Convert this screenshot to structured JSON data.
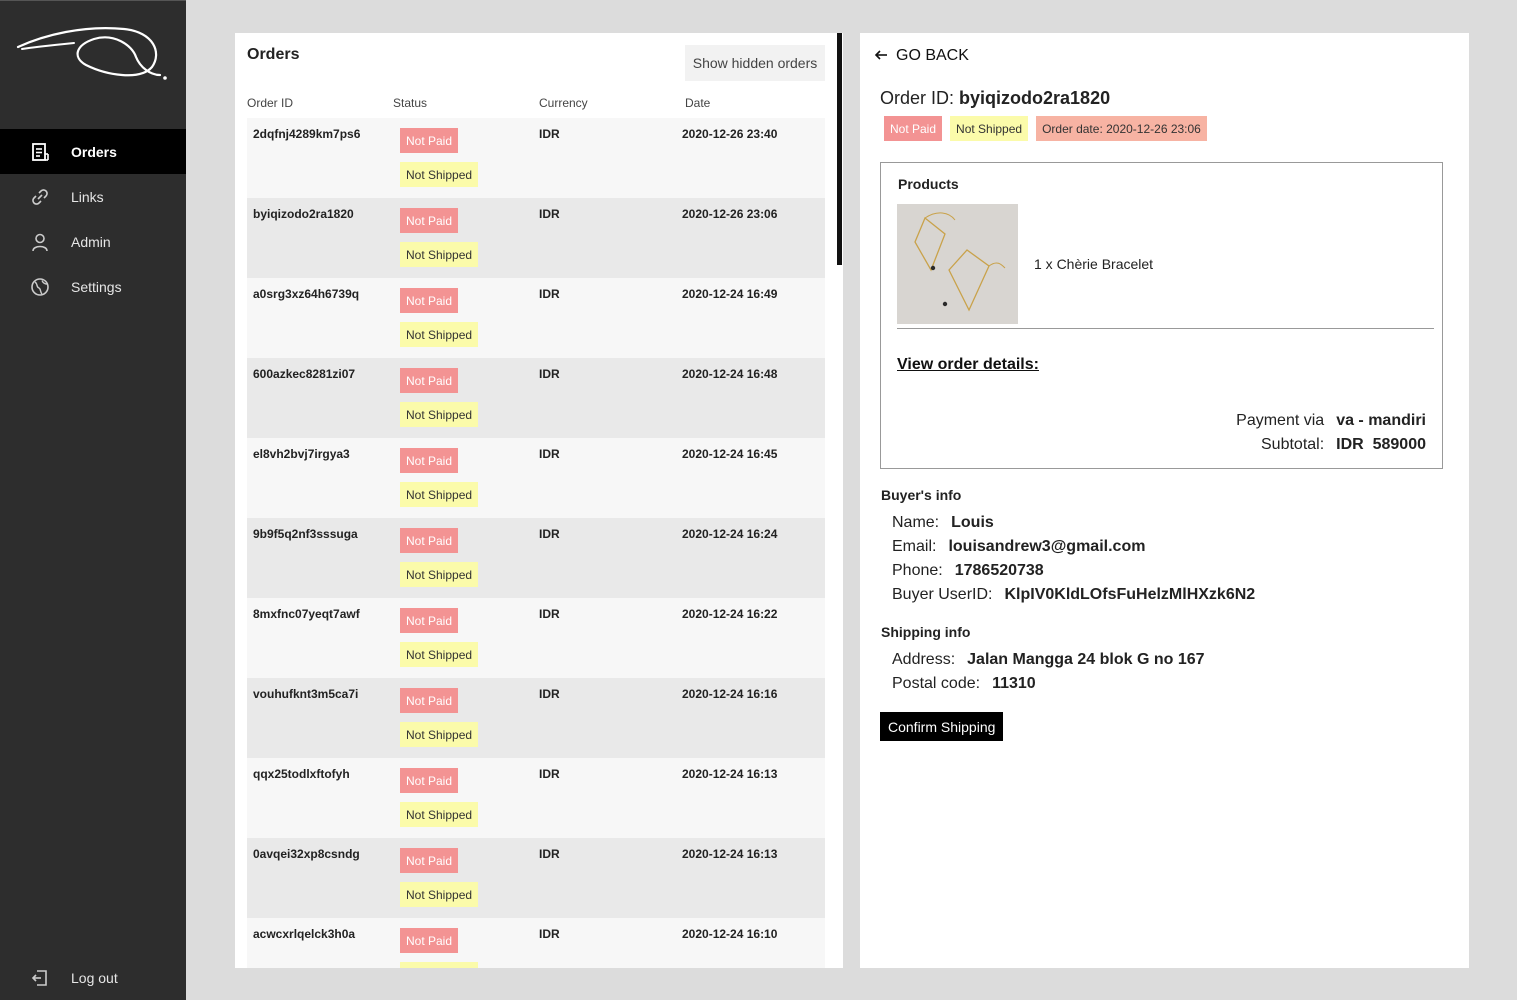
{
  "sidebar": {
    "items": [
      {
        "label": "Orders",
        "icon": "document-list-icon"
      },
      {
        "label": "Links",
        "icon": "link-icon"
      },
      {
        "label": "Admin",
        "icon": "user-icon"
      },
      {
        "label": "Settings",
        "icon": "globe-icon"
      }
    ],
    "logout_label": "Log out"
  },
  "orders": {
    "title": "Orders",
    "show_hidden_label": "Show hidden orders",
    "columns": [
      "Order ID",
      "Status",
      "Currency",
      "Date"
    ],
    "rows": [
      {
        "id": "2dqfnj4289km7ps6",
        "paid": "Not Paid",
        "shipped": "Not Shipped",
        "currency": "IDR",
        "date": "2020-12-26 23:40"
      },
      {
        "id": "byiqizodo2ra1820",
        "paid": "Not Paid",
        "shipped": "Not Shipped",
        "currency": "IDR",
        "date": "2020-12-26 23:06"
      },
      {
        "id": "a0srg3xz64h6739q",
        "paid": "Not Paid",
        "shipped": "Not Shipped",
        "currency": "IDR",
        "date": "2020-12-24 16:49"
      },
      {
        "id": "600azkec8281zi07",
        "paid": "Not Paid",
        "shipped": "Not Shipped",
        "currency": "IDR",
        "date": "2020-12-24 16:48"
      },
      {
        "id": "el8vh2bvj7irgya3",
        "paid": "Not Paid",
        "shipped": "Not Shipped",
        "currency": "IDR",
        "date": "2020-12-24 16:45"
      },
      {
        "id": "9b9f5q2nf3sssuga",
        "paid": "Not Paid",
        "shipped": "Not Shipped",
        "currency": "IDR",
        "date": "2020-12-24 16:24"
      },
      {
        "id": "8mxfnc07yeqt7awf",
        "paid": "Not Paid",
        "shipped": "Not Shipped",
        "currency": "IDR",
        "date": "2020-12-24 16:22"
      },
      {
        "id": "vouhufknt3m5ca7i",
        "paid": "Not Paid",
        "shipped": "Not Shipped",
        "currency": "IDR",
        "date": "2020-12-24 16:16"
      },
      {
        "id": "qqx25todlxftofyh",
        "paid": "Not Paid",
        "shipped": "Not Shipped",
        "currency": "IDR",
        "date": "2020-12-24 16:13"
      },
      {
        "id": "0avqei32xp8csndg",
        "paid": "Not Paid",
        "shipped": "Not Shipped",
        "currency": "IDR",
        "date": "2020-12-24 16:13"
      },
      {
        "id": "acwcxrlqelck3h0a",
        "paid": "Not Paid",
        "shipped": "Not Shipped",
        "currency": "IDR",
        "date": "2020-12-24 16:10"
      }
    ]
  },
  "detail": {
    "go_back_label": "GO BACK",
    "order_id_label": "Order ID:",
    "order_id": "byiqizodo2ra1820",
    "badge_paid": "Not Paid",
    "badge_shipped": "Not Shipped",
    "badge_date": "Order date: 2020-12-26 23:06",
    "products_title": "Products",
    "product_line": "1 x Chèrie Bracelet",
    "view_details_label": "View order details:",
    "payment_label": "Payment via",
    "payment_value": "va - mandiri",
    "subtotal_label": "Subtotal:",
    "subtotal_value": "IDR  589000",
    "buyer_title": "Buyer's info",
    "name_label": "Name:",
    "name_value": "Louis",
    "email_label": "Email:",
    "email_value": "louisandrew3@gmail.com",
    "phone_label": "Phone:",
    "phone_value": "1786520738",
    "userid_label": "Buyer UserID:",
    "userid_value": "KlpIV0KldLOfsFuHelzMlHXzk6N2",
    "shipping_title": "Shipping info",
    "address_label": "Address:",
    "address_value": "Jalan Mangga 24 blok G no 167",
    "postal_label": "Postal code:",
    "postal_value": "11310",
    "confirm_label": "Confirm Shipping"
  },
  "colors": {
    "sidebar_bg": "#2d2d2d",
    "not_paid": "#f39393",
    "not_shipped": "#fbfbaa",
    "order_date": "#f7b3a3"
  }
}
